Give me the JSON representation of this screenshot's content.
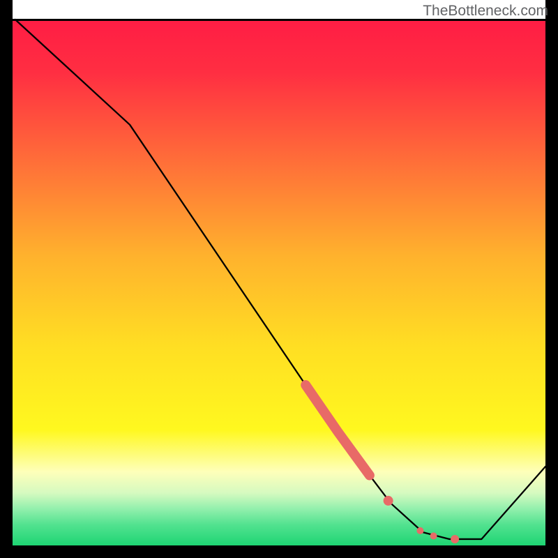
{
  "watermark": "TheBottleneck.com",
  "colors": {
    "frame": "#000000",
    "line": "#000000",
    "salmon": "#e86a67",
    "top_red": "#ff1d44",
    "mid_orange": "#ffa432",
    "yellow": "#ffe620",
    "pale_yellow": "#feffc0",
    "mint": "#6be9a3",
    "green": "#1fd574"
  },
  "chart_data": {
    "type": "line",
    "title": "",
    "xlabel": "",
    "ylabel": "",
    "xlim": [
      0,
      100
    ],
    "ylim": [
      0,
      100
    ],
    "series": [
      {
        "name": "curve",
        "points": [
          {
            "x": 0.5,
            "y": 100
          },
          {
            "x": 22,
            "y": 80
          },
          {
            "x": 59,
            "y": 24.5
          },
          {
            "x": 65,
            "y": 16
          },
          {
            "x": 71,
            "y": 8
          },
          {
            "x": 77,
            "y": 2.5
          },
          {
            "x": 82,
            "y": 1.2
          },
          {
            "x": 88,
            "y": 1.2
          },
          {
            "x": 100,
            "y": 15
          }
        ]
      }
    ],
    "highlight_segment": {
      "x_start": 55,
      "x_end": 67
    },
    "highlight_dots": [
      {
        "x": 70.5,
        "y": 8.5
      },
      {
        "x": 76.5,
        "y": 2.8
      },
      {
        "x": 79,
        "y": 1.8
      },
      {
        "x": 83,
        "y": 1.2
      }
    ]
  }
}
